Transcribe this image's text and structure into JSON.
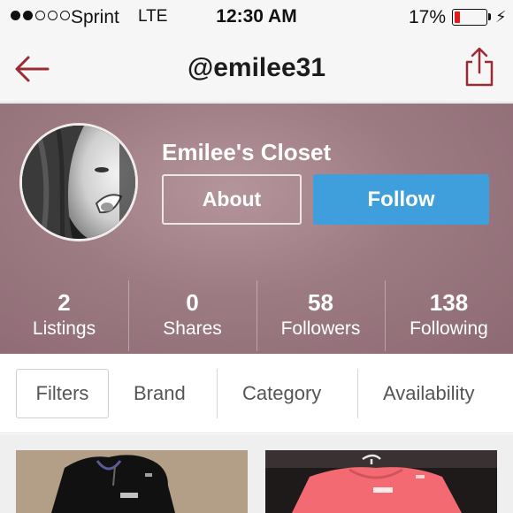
{
  "status_bar": {
    "carrier": "Sprint",
    "network": "LTE",
    "time": "12:30 AM",
    "battery_percent_label": "17%",
    "battery_level": 0.17,
    "signal_bars_filled": 2,
    "signal_bars_total": 5,
    "battery_color": "#e21b1b"
  },
  "nav": {
    "title": "@emilee31",
    "back_icon": "back-arrow-icon",
    "share_icon": "share-icon",
    "icon_color": "#9b2b32"
  },
  "profile": {
    "closet_name": "Emilee's Closet",
    "about_label": "About",
    "follow_label": "Follow",
    "follow_color": "#3f9edc",
    "header_color": "#9d7b83"
  },
  "stats": [
    {
      "value": "2",
      "label": "Listings"
    },
    {
      "value": "0",
      "label": "Shares"
    },
    {
      "value": "58",
      "label": "Followers"
    },
    {
      "value": "138",
      "label": "Following"
    }
  ],
  "filters": {
    "filters_label": "Filters",
    "brand_label": "Brand",
    "category_label": "Category",
    "availability_label": "Availability"
  },
  "listings": [
    {
      "icon": "black-hoodie-thumbnail"
    },
    {
      "icon": "pink-hoodie-thumbnail"
    }
  ]
}
